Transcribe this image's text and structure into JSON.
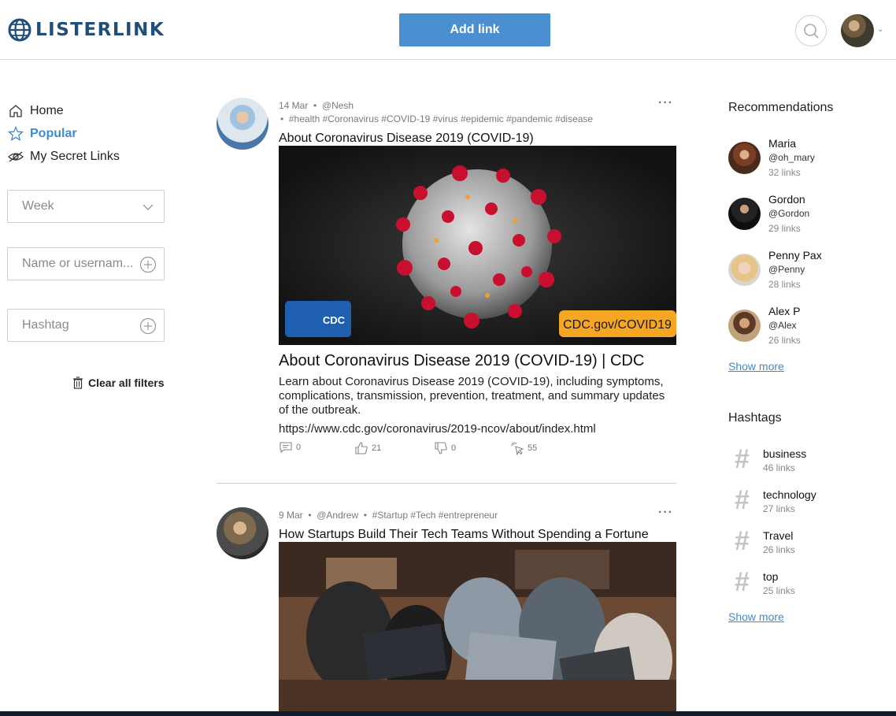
{
  "app": {
    "logo_text": "LISTERLINK"
  },
  "header": {
    "add_link_label": "Add link",
    "search_icon": "search-icon",
    "chevron": "⌄"
  },
  "nav": [
    {
      "label": "Home",
      "icon": "home-icon"
    },
    {
      "label": "Popular",
      "icon": "star-icon"
    },
    {
      "label": "My Secret Links",
      "icon": "eye-hidden-icon"
    }
  ],
  "filters": {
    "period_selected": "Week",
    "name_placeholder": "Name or usernam...",
    "hashtag_placeholder": "Hashtag",
    "clear_label": "Clear all filters"
  },
  "posts": [
    {
      "date": "14 Mar",
      "author": "@Nesh",
      "hashtags": "#health #Coronavirus #COVID-19 #virus #epidemic #pandemic #disease",
      "title": "About Coronavirus Disease 2019 (COVID-19)",
      "image_badge": "CDC.gov/COVID19",
      "image_logo": "CDC",
      "link_title": "About Coronavirus Disease 2019 (COVID-19) | CDC",
      "link_desc": "Learn about Coronavirus Disease 2019 (COVID-19), including symptoms, complications, transmission, prevention, treatment, and summary updates of the outbreak.",
      "link_url": "https://www.cdc.gov/coronavirus/2019-ncov/about/index.html",
      "comments": "0",
      "likes": "21",
      "dislikes": "0",
      "clicks": "55"
    },
    {
      "date": "9 Mar",
      "author": "@Andrew",
      "hashtags": "#Startup #Tech #entrepreneur",
      "title": "How Startups Build Their Tech Teams Without Spending a Fortune"
    }
  ],
  "recommendations": {
    "title": "Recommendations",
    "people": [
      {
        "name": "Maria",
        "handle": "@oh_mary",
        "count": "32 links"
      },
      {
        "name": "Gordon",
        "handle": "@Gordon",
        "count": "29 links"
      },
      {
        "name": "Penny Pax",
        "handle": "@Penny",
        "count": "28 links"
      },
      {
        "name": "Alex P",
        "handle": "@Alex",
        "count": "26 links"
      }
    ],
    "show_more": "Show more"
  },
  "hashtags": {
    "title": "Hashtags",
    "items": [
      {
        "name": "business",
        "count": "46 links"
      },
      {
        "name": "technology",
        "count": "27 links"
      },
      {
        "name": "Travel",
        "count": "26 links"
      },
      {
        "name": "top",
        "count": "25 links"
      }
    ],
    "show_more": "Show more"
  },
  "colors": {
    "accent": "#4a8fd0",
    "brand": "#1f4e79",
    "badge": "#f5a623"
  }
}
